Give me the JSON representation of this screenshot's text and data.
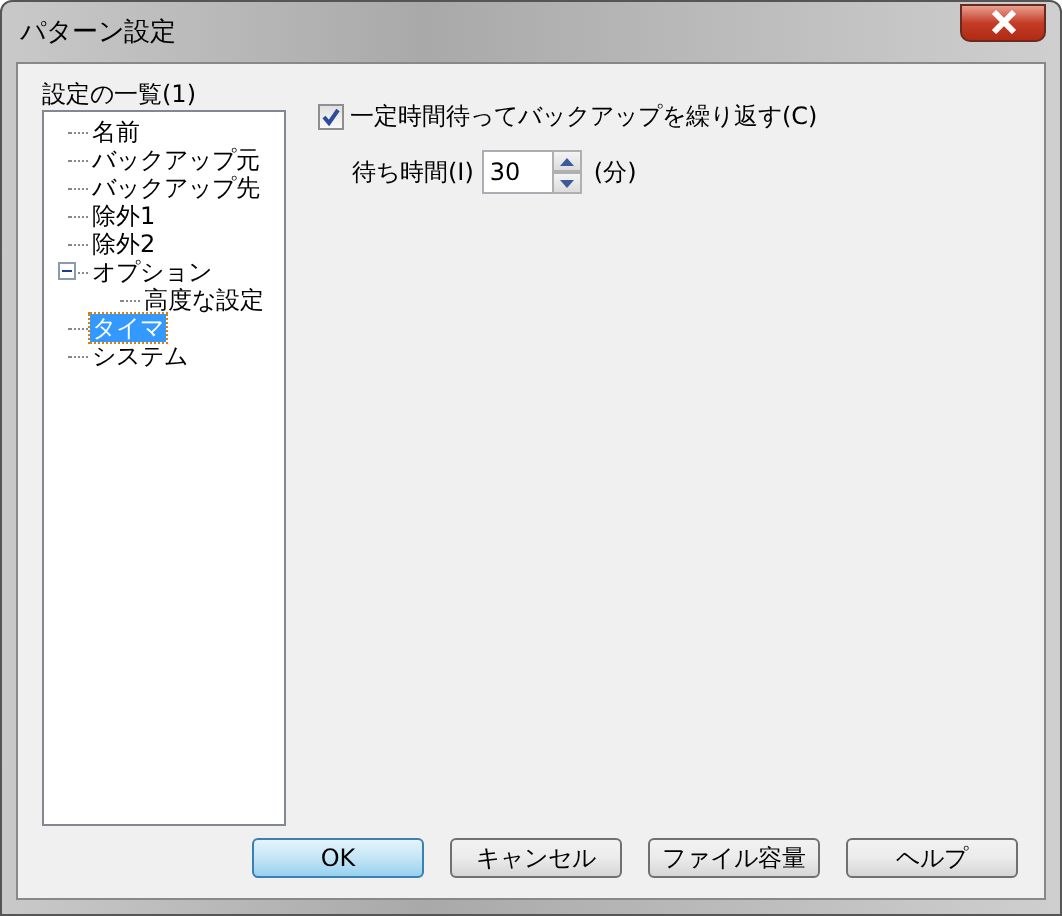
{
  "window": {
    "title": "パターン設定"
  },
  "settings_list": {
    "label": "設定の一覧(1)",
    "items": [
      {
        "label": "名前",
        "selected": false
      },
      {
        "label": "バックアップ元",
        "selected": false
      },
      {
        "label": "バックアップ先",
        "selected": false
      },
      {
        "label": "除外1",
        "selected": false
      },
      {
        "label": "除外2",
        "selected": false
      },
      {
        "label": "オプション",
        "selected": false,
        "expanded": true,
        "children": [
          {
            "label": "高度な設定",
            "selected": false
          }
        ]
      },
      {
        "label": "タイマ",
        "selected": true
      },
      {
        "label": "システム",
        "selected": false
      }
    ]
  },
  "repeat_checkbox": {
    "label": "一定時間待ってバックアップを繰り返す(C)",
    "checked": true
  },
  "wait_time": {
    "label": "待ち時間(I)",
    "value": "30",
    "unit": "(分)"
  },
  "buttons": [
    {
      "label": "OK",
      "kind": "default"
    },
    {
      "label": "キャンセル",
      "kind": "normal"
    },
    {
      "label": "ファイル容量",
      "kind": "normal"
    },
    {
      "label": "ヘルプ",
      "kind": "normal"
    }
  ]
}
